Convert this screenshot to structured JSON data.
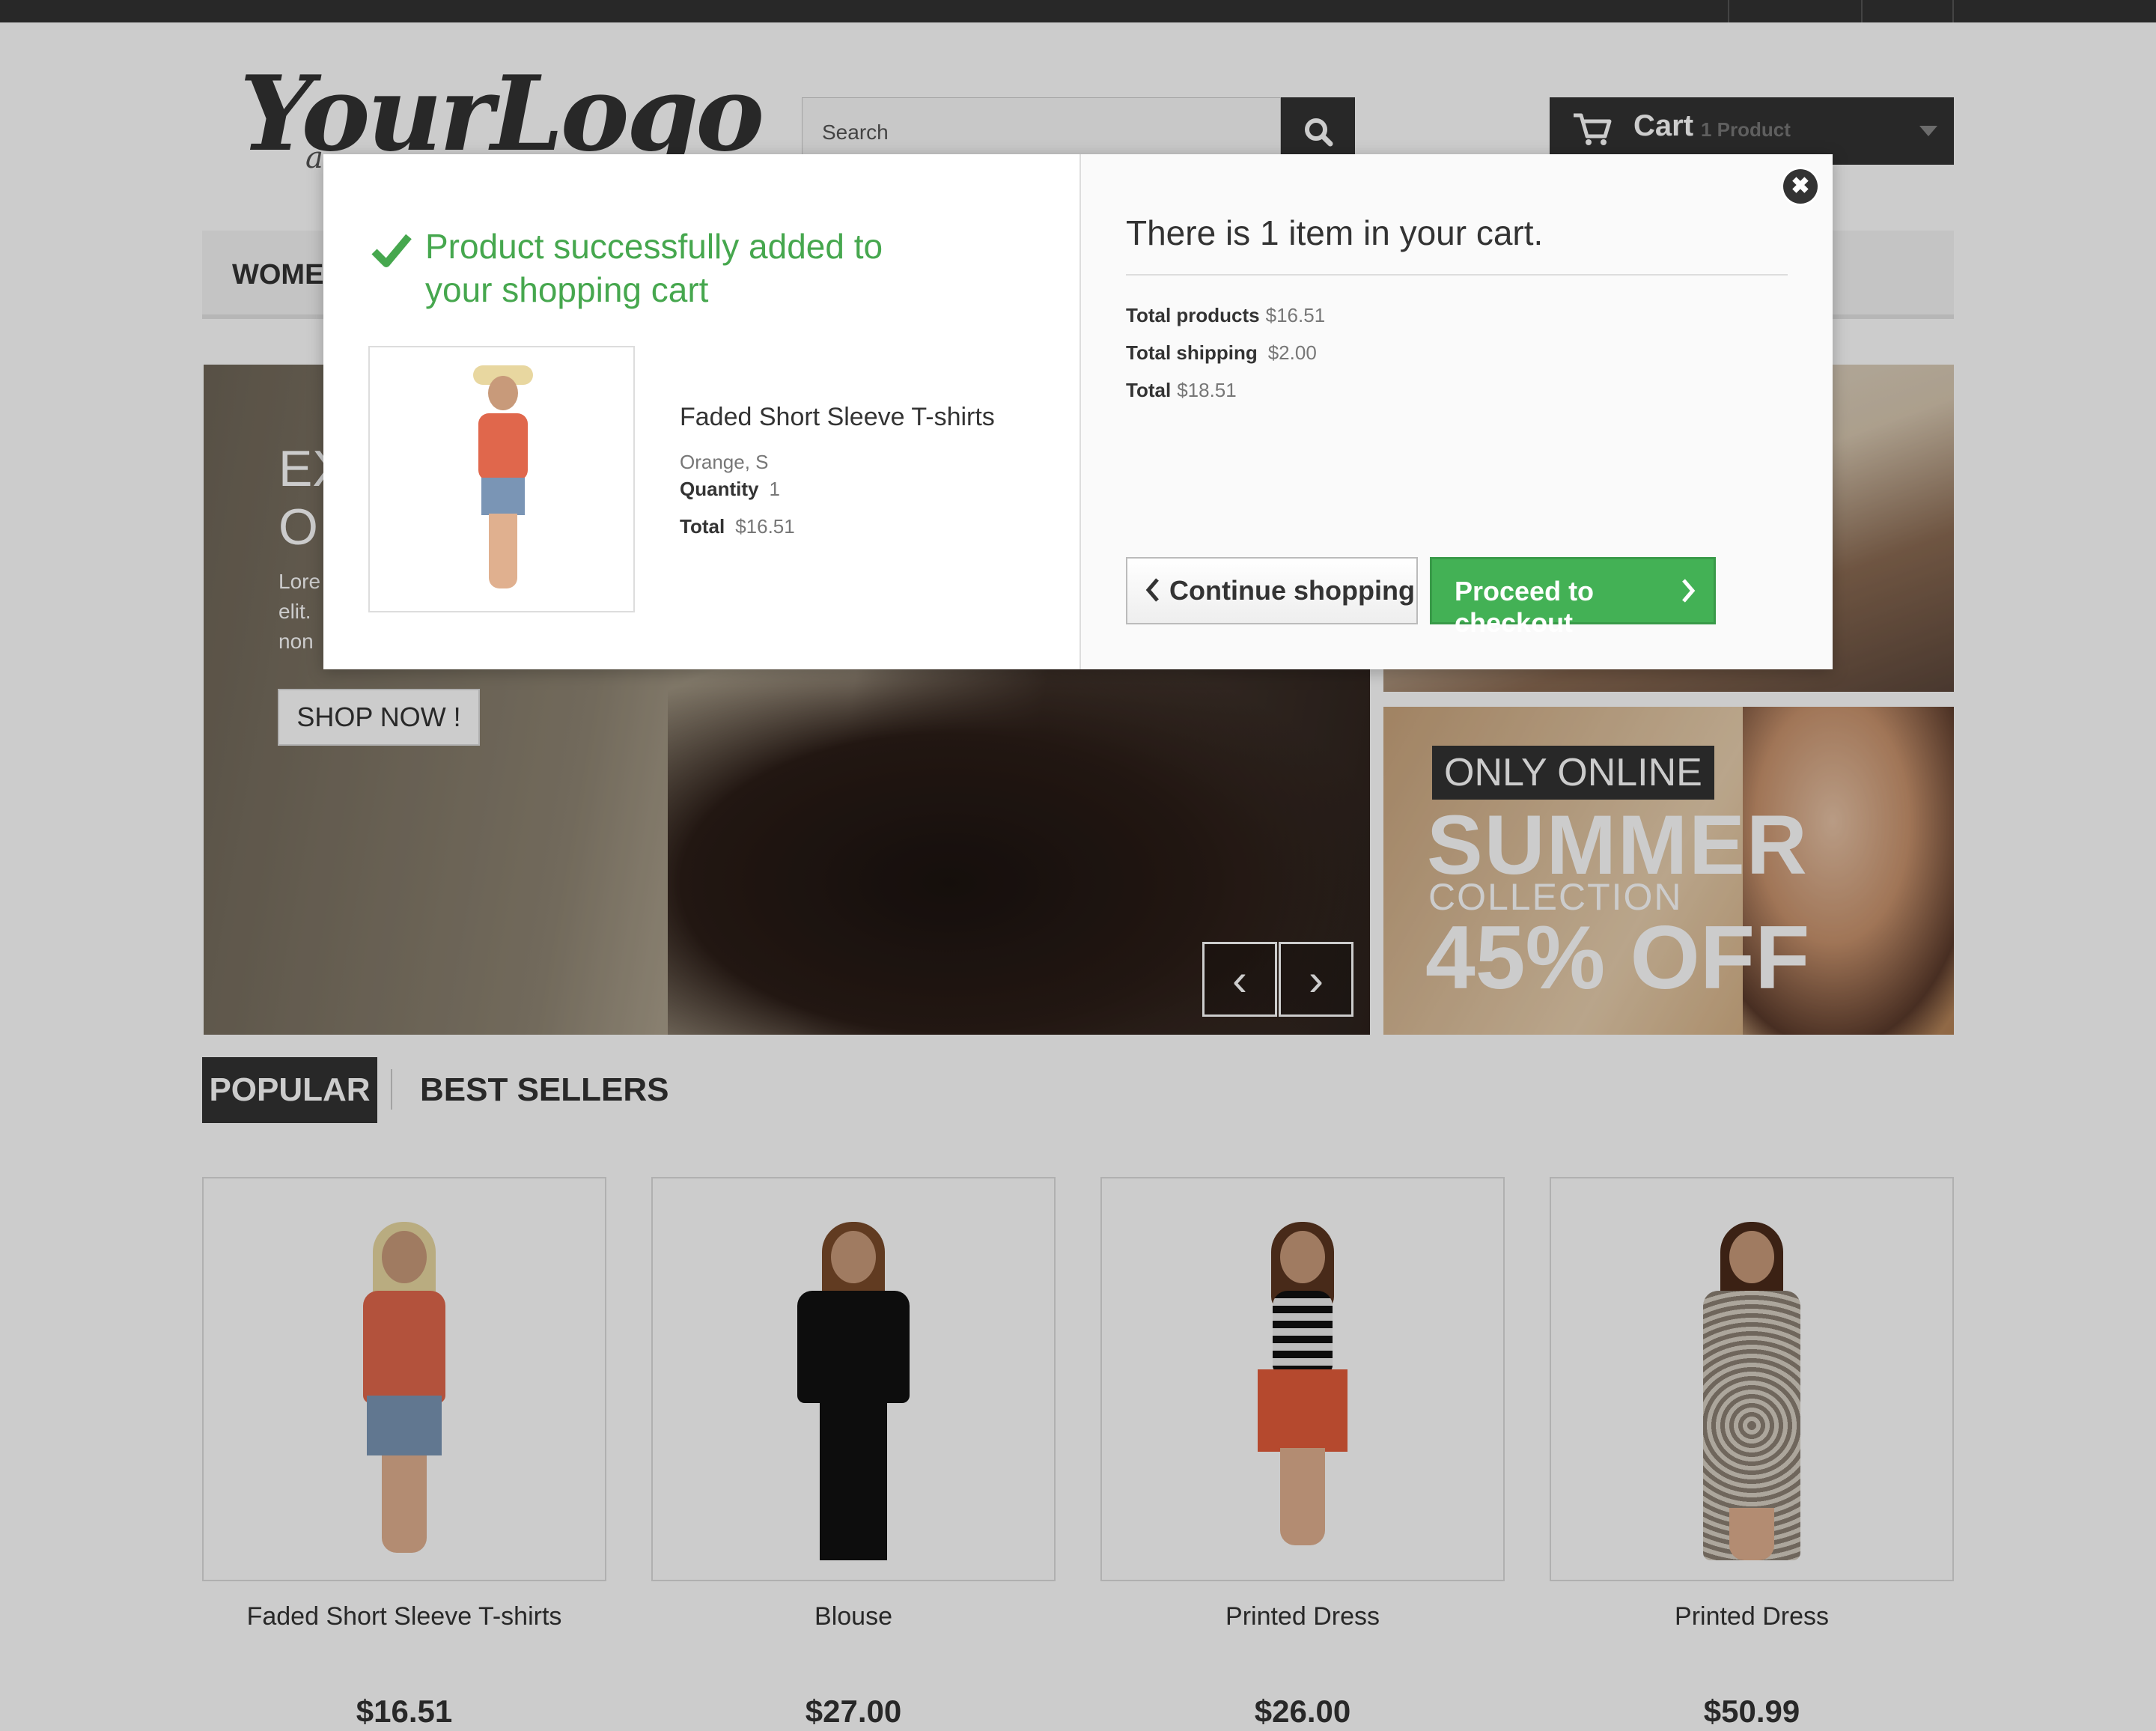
{
  "header": {
    "logo_text": "YourLogo",
    "logo_sub": "a...",
    "search_placeholder": "Search",
    "cart_label": "Cart",
    "cart_count": "1 Product"
  },
  "menu": {
    "first_item": "WOMEN"
  },
  "slider": {
    "headline_line1": "EX",
    "headline_line2": "O",
    "text_line1": "Lore",
    "text_line2": "elit.",
    "text_line3": "non",
    "shop_now": "SHOP NOW !",
    "prev_glyph": "‹",
    "next_glyph": "›"
  },
  "banner": {
    "tag": "ONLY ONLINE",
    "title": "SUMMER",
    "subtitle": "COLLECTION",
    "discount": "45% OFF"
  },
  "tabs": {
    "popular": "POPULAR",
    "best_sellers": "BEST SELLERS"
  },
  "products": [
    {
      "name": "Faded Short Sleeve T-shirts",
      "price": "$16.51"
    },
    {
      "name": "Blouse",
      "price": "$27.00"
    },
    {
      "name": "Printed Dress",
      "price": "$26.00"
    },
    {
      "name": "Printed Dress",
      "price": "$50.99"
    }
  ],
  "modal": {
    "success_line1": "Product successfully added to",
    "success_line2": "your shopping cart",
    "item_name": "Faded Short Sleeve T-shirts",
    "item_attributes": "Orange, S",
    "quantity_label": "Quantity",
    "quantity_value": "1",
    "total_label": "Total",
    "total_value": "$16.51",
    "cart_heading": "There is 1 item in your cart.",
    "total_products_label": "Total products",
    "total_products_value": "$16.51",
    "total_shipping_label": "Total shipping",
    "total_shipping_value": "$2.00",
    "grand_total_label": "Total",
    "grand_total_value": "$18.51",
    "continue_label": "Continue shopping",
    "checkout_label": "Proceed to checkout",
    "close_glyph": "✖"
  },
  "colors": {
    "success_green": "#46a74e",
    "checkout_green": "#43b155",
    "dark": "#333333"
  },
  "icons": [
    "search-icon",
    "cart-icon",
    "chevron-down-icon",
    "check-icon",
    "close-icon",
    "chevron-left-icon",
    "chevron-right-icon"
  ]
}
